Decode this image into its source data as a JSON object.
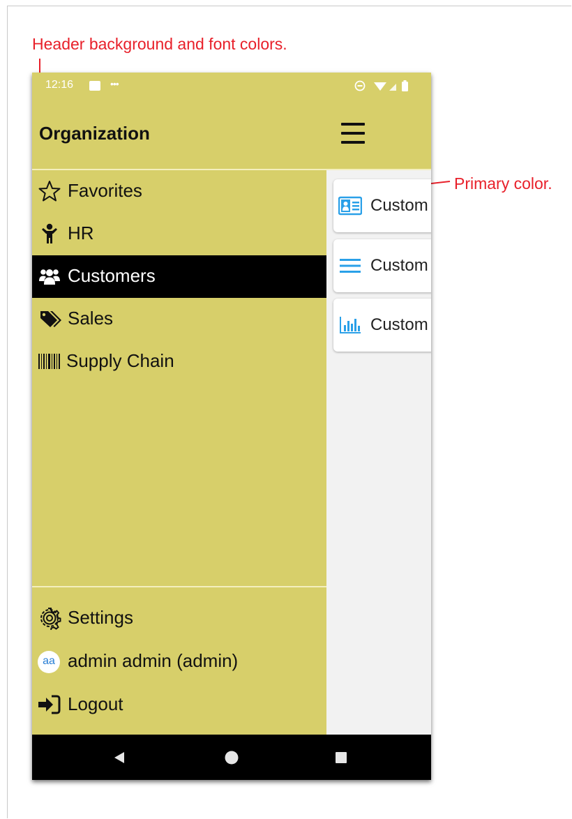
{
  "annotations": {
    "header_note": "Header background and font colors.",
    "primary_note": "Primary color."
  },
  "status_bar": {
    "time": "12:16",
    "left_icons": [
      "image-icon",
      "more-dots-icon"
    ],
    "right_icons": [
      "do-not-disturb-icon",
      "wifi-icon",
      "signal-icon",
      "battery-icon"
    ]
  },
  "header": {
    "title": "Organization",
    "menu_icon": "hamburger-icon"
  },
  "drawer": {
    "items": [
      {
        "label": "Favorites",
        "icon": "star-icon",
        "active": false
      },
      {
        "label": "HR",
        "icon": "person-icon",
        "active": false
      },
      {
        "label": "Customers",
        "icon": "users-icon",
        "active": true
      },
      {
        "label": "Sales",
        "icon": "tags-icon",
        "active": false
      },
      {
        "label": "Supply Chain",
        "icon": "barcode-icon",
        "active": false
      }
    ],
    "footer_items": [
      {
        "label": "Settings",
        "icon": "gear-icon"
      },
      {
        "label": "admin admin (admin)",
        "icon": "avatar",
        "avatar_text": "aa"
      },
      {
        "label": "Logout",
        "icon": "logout-icon"
      }
    ]
  },
  "content": {
    "cards": [
      {
        "label": "Custom",
        "icon": "contact-card-icon"
      },
      {
        "label": "Custom",
        "icon": "list-icon"
      },
      {
        "label": "Custom",
        "icon": "bar-chart-icon"
      }
    ]
  },
  "nav_bar": {
    "icons": [
      "back-icon",
      "home-icon",
      "recents-icon"
    ]
  },
  "colors": {
    "header_background": "#d7cf6a",
    "header_font": "#111111",
    "primary": "#2aa0e8",
    "active_item_background": "#000000",
    "annotation": "#e8202a"
  }
}
